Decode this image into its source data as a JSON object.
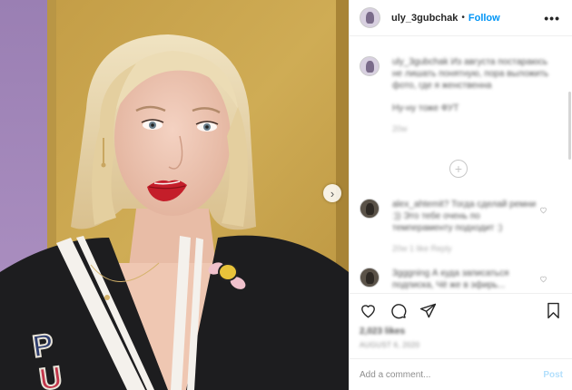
{
  "post": {
    "username": "uly_3gubchak",
    "dot": "•",
    "follow_label": "Follow",
    "more_label": "•••",
    "next_label": "›"
  },
  "comments": {
    "caption": {
      "text": "uly_3gubchak Из августа постараюсь не лишать понятную, пора выложить фото, где я женственна",
      "subtext": "Ну-ну тоже ФУТ",
      "meta": "20w"
    },
    "load_more_label": "+",
    "items": [
      {
        "text": "alex_ahtemit? Тогда сделай ремни :)) Это тебе очень по темпераменту подходит :)",
        "meta": "20w   1 like   Reply"
      },
      {
        "text": "3gggning А куда записаться подписка, Чё же в эфирь..."
      }
    ]
  },
  "actions": {
    "likes": "2,023 likes",
    "posted": "AUGUST 6, 2020"
  },
  "composer": {
    "placeholder": "Add a comment...",
    "post_label": "Post"
  },
  "colors": {
    "accent": "#0095f6",
    "post_disabled": "#b2dffc",
    "wall": "#c9a54e",
    "lipstick": "#c41e2a"
  },
  "icons": [
    "heart-icon",
    "comment-icon",
    "share-icon",
    "bookmark-icon",
    "more-icon",
    "chevron-right-icon",
    "add-circle-icon"
  ]
}
